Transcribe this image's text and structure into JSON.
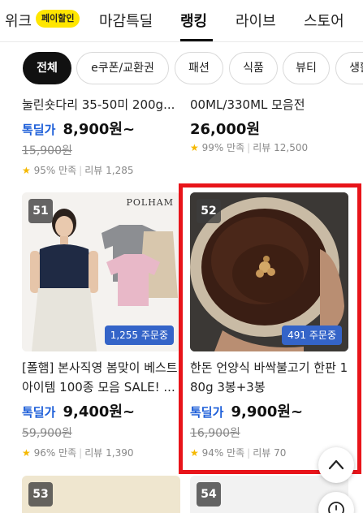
{
  "nav": {
    "items": [
      {
        "label": "위크"
      },
      {
        "label": "마감특딜"
      },
      {
        "label": "랭킹"
      },
      {
        "label": "라이브"
      },
      {
        "label": "스토어"
      }
    ],
    "pay_badge": "페이할인",
    "active": "랭킹"
  },
  "chips": [
    {
      "label": "전체"
    },
    {
      "label": "e쿠폰/교환권"
    },
    {
      "label": "패션"
    },
    {
      "label": "식품"
    },
    {
      "label": "뷰티"
    },
    {
      "label": "생활"
    }
  ],
  "products_top": [
    {
      "title": "눌린숏다리 35-50미 200g...",
      "deal_label": "톡딜가",
      "price": "8,900원~",
      "original_price": "15,900원",
      "satisfaction": "95% 만족",
      "reviews": "리뷰 1,285"
    },
    {
      "title": "00ML/330ML 모음전",
      "deal_label": "",
      "price": "26,000원",
      "original_price": "",
      "satisfaction": "99% 만족",
      "reviews": "리뷰 12,500"
    }
  ],
  "products_main": [
    {
      "rank": "51",
      "brand_watermark": "POLHAM",
      "orders": "1,255 주문중",
      "title": "[폴햄] 본사직영 봄맞이 베스트 아이템 100종 모음 SALE! ...",
      "deal_label": "톡딜가",
      "price": "9,400원~",
      "original_price": "59,900원",
      "satisfaction": "96% 만족",
      "reviews": "리뷰 1,390"
    },
    {
      "rank": "52",
      "orders": "491 주문중",
      "title": "한돈 언양식 바싹불고기 한판 180g 3봉+3봉",
      "deal_label": "톡딜가",
      "price": "9,900원~",
      "original_price": "16,900원",
      "satisfaction": "94% 만족",
      "reviews": "리뷰 70"
    }
  ],
  "products_next": [
    {
      "rank": "53"
    },
    {
      "rank": "54"
    }
  ],
  "colors": {
    "deal_blue": "#1e5fd9",
    "order_badge": "#3464c8",
    "highlight": "#e8141a",
    "star": "#f5b800",
    "pay_badge": "#ffe600"
  }
}
